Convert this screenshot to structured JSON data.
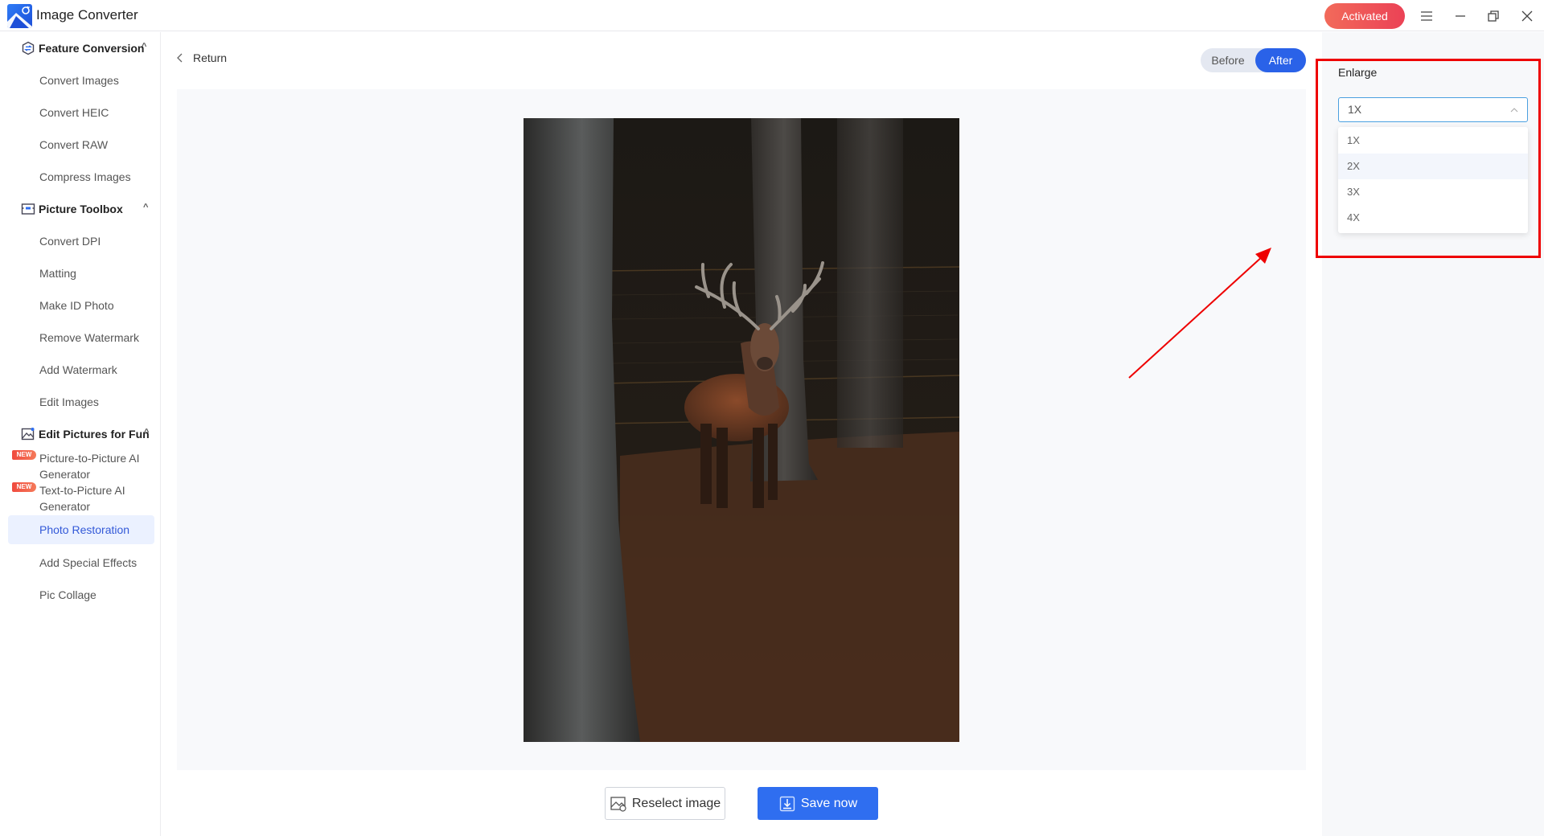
{
  "app": {
    "title": "Image Converter",
    "activated_label": "Activated",
    "window_controls": [
      "menu-icon",
      "minimize-icon",
      "restore-icon",
      "close-icon"
    ]
  },
  "sidebar": {
    "groups": [
      {
        "label": "Feature Conversion",
        "icon": "convert-icon",
        "expanded": true,
        "items": [
          {
            "label": "Convert Images"
          },
          {
            "label": "Convert HEIC"
          },
          {
            "label": "Convert RAW"
          },
          {
            "label": "Compress Images"
          }
        ]
      },
      {
        "label": "Picture Toolbox",
        "icon": "toolbox-icon",
        "expanded": true,
        "items": [
          {
            "label": "Convert DPI"
          },
          {
            "label": "Matting"
          },
          {
            "label": "Make ID Photo"
          },
          {
            "label": "Remove Watermark"
          },
          {
            "label": "Add Watermark"
          },
          {
            "label": "Edit Images"
          }
        ]
      },
      {
        "label": "Edit Pictures for Fun",
        "icon": "fun-picture-icon",
        "expanded": true,
        "items": [
          {
            "label": "Picture-to-Picture AI Generator",
            "line1": "Picture-to-Picture AI",
            "line2": "Generator",
            "badge": "NEW"
          },
          {
            "label": "Text-to-Picture AI Generator",
            "line1": "Text-to-Picture AI",
            "line2": "Generator",
            "badge": "NEW"
          },
          {
            "label": "Photo Restoration",
            "active": true
          },
          {
            "label": "Add Special Effects"
          },
          {
            "label": "Pic Collage"
          }
        ]
      }
    ]
  },
  "main": {
    "return_label": "Return",
    "compare_toggle": {
      "options": [
        "Before",
        "After"
      ],
      "selected": "After"
    },
    "preview_image": "deer-in-forest-photo",
    "buttons": {
      "reselect": "Reselect image",
      "save": "Save now"
    }
  },
  "settings_panel": {
    "enlarge_label": "Enlarge",
    "enlarge_value": "1X",
    "enlarge_options": [
      "1X",
      "2X",
      "3X",
      "4X"
    ],
    "hovered_option": "2X",
    "dropdown_open": true
  },
  "annotations": {
    "highlight_color": "#ee0000",
    "highlight_target": "enlarge-dropdown",
    "arrow_color": "#ee0000"
  },
  "colors": {
    "accent": "#2f6ef0",
    "activated_gradient_start": "#f26a5a",
    "activated_gradient_end": "#eb4256",
    "active_item_bg": "#ebf1ff",
    "active_item_text": "#3359d8"
  }
}
